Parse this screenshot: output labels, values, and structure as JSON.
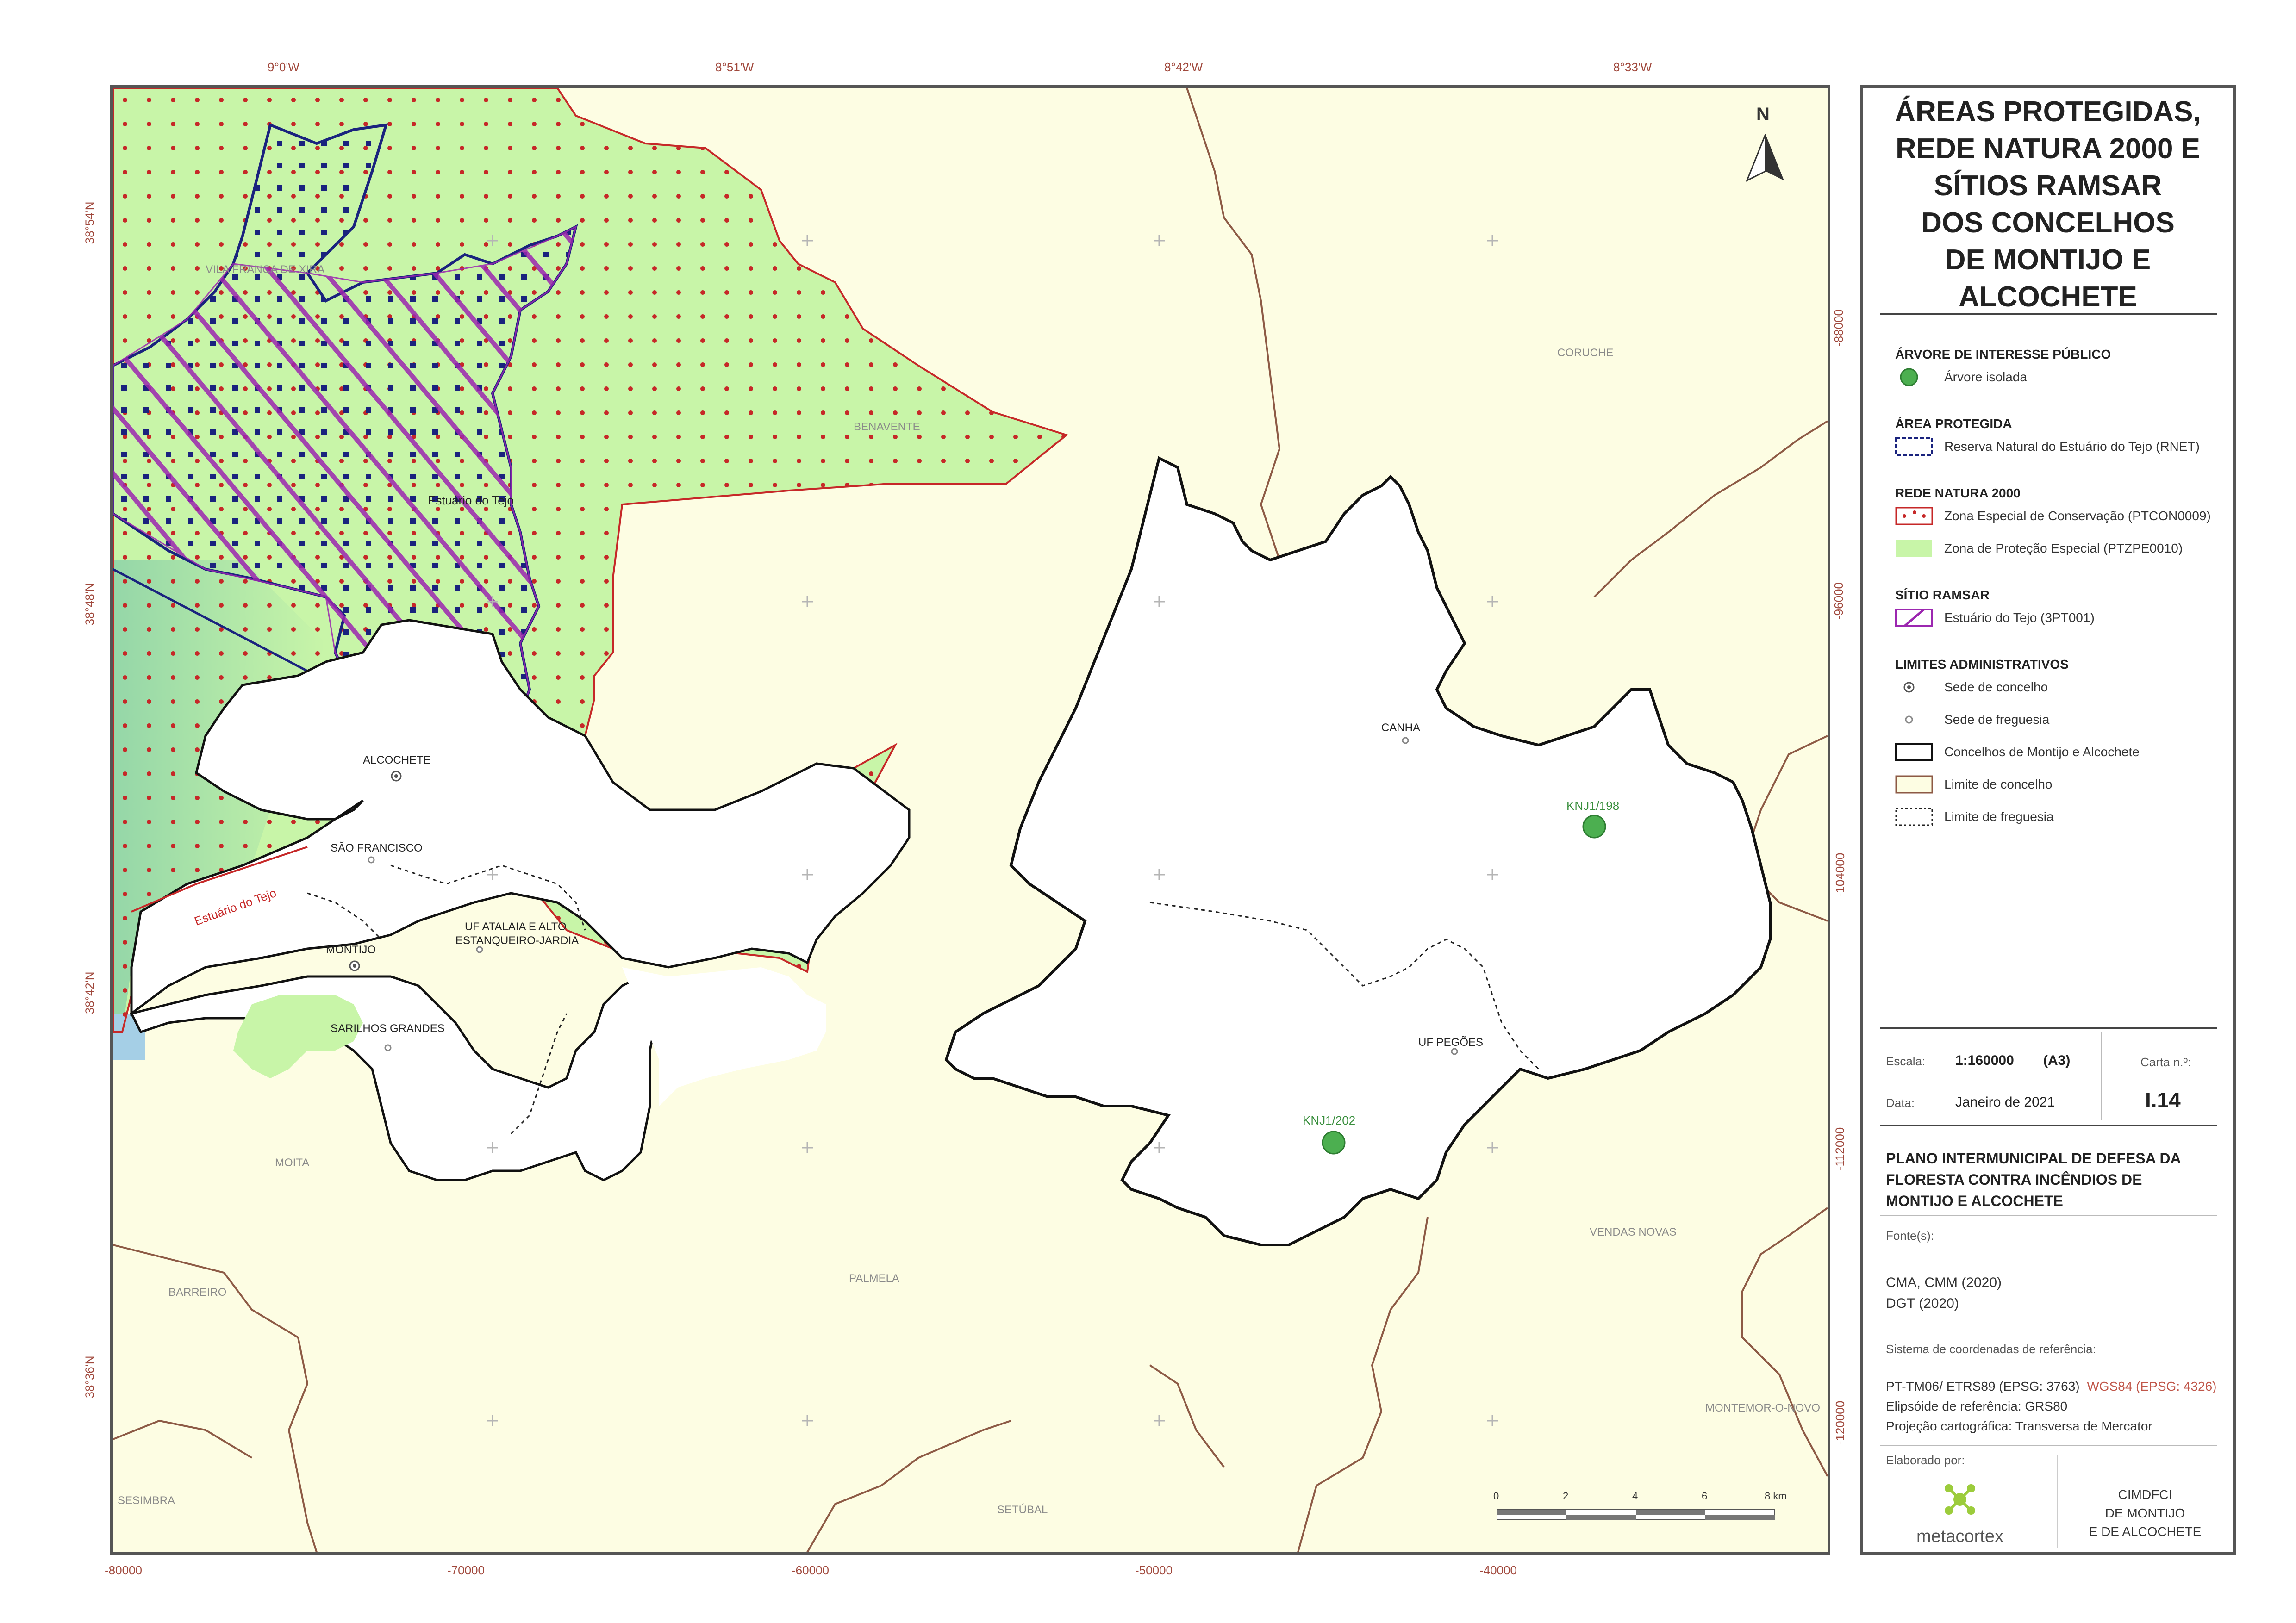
{
  "map": {
    "top_coords": [
      "9°0'W",
      "8°51'W",
      "8°42'W",
      "8°33'W"
    ],
    "left_coords": [
      "38°54'N",
      "38°48'N",
      "38°42'N",
      "38°36'N"
    ],
    "bottom_coords": [
      "-80000",
      "-70000",
      "-60000",
      "-50000",
      "-40000"
    ],
    "right_coords": [
      "-88000",
      "-96000",
      "-104000",
      "-112000",
      "-120000"
    ],
    "place_names": {
      "vila_franca": "VILA FRANCA DE XIRA",
      "benavente": "BENAVENTE",
      "coruche": "CORUCHE",
      "estuario": "Estuário do Tejo",
      "estuario_river": "Estuário do Tejo",
      "alcochete": "ALCOCHETE",
      "sao_francisco": "SÃO FRANCISCO",
      "uf_atalaia": "UF ATALAIA E ALTO",
      "uf_atalaia_2": "ESTANQUEIRO-JARDIA",
      "montijo": "MONTIJO",
      "sarilhos": "SARILHOS GRANDES",
      "moita": "MOITA",
      "barreiro": "BARREIRO",
      "palmela": "PALMELA",
      "sesimbra": "SESIMBRA",
      "setubal": "SETÚBAL",
      "canha": "CANHA",
      "uf_pegoes": "UF PEGÕES",
      "vendas_novas": "VENDAS NOVAS",
      "montemor": "MONTEMOR-O-NOVO"
    },
    "trees": [
      {
        "id": "KNJ1/198"
      },
      {
        "id": "KNJ1/202"
      }
    ],
    "north_label": "N",
    "scale_ticks": [
      "0",
      "2",
      "4",
      "6",
      "8 km"
    ]
  },
  "legend": {
    "title": [
      "ÁREAS PROTEGIDAS,",
      "REDE NATURA 2000 E",
      "SÍTIOS RAMSAR",
      "DOS CONCELHOS",
      "DE MONTIJO E",
      "ALCOCHETE"
    ],
    "sections": {
      "arvore_head": "ÁRVORE DE INTERESSE PÚBLICO",
      "arvore_item": "Árvore isolada",
      "area_head": "ÁREA PROTEGIDA",
      "area_item": "Reserva Natural do Estuário do Tejo (RNET)",
      "natura_head": "REDE NATURA 2000",
      "natura_item1": "Zona Especial de Conservação (PTCON0009)",
      "natura_item2": "Zona de Proteção Especial (PTZPE0010)",
      "ramsar_head": "SÍTIO RAMSAR",
      "ramsar_item": "Estuário do Tejo (3PT001)",
      "limites_head": "LIMITES ADMINISTRATIVOS",
      "lim1": "Sede de concelho",
      "lim2": "Sede de freguesia",
      "lim3": "Concelhos de Montijo e Alcochete",
      "lim4": "Limite de concelho",
      "lim5": "Limite de freguesia"
    },
    "colors": {
      "tree": "#4caf50",
      "rnet": "#1a237e",
      "zec_dots": "#c62828",
      "zpe": "#c8f5a8",
      "ramsar": "#9c27b0",
      "concelho_fill": "#fdfde3",
      "concelho_line": "#8d5a45"
    }
  },
  "info": {
    "escala_label": "Escala:",
    "escala_value": "1:160000",
    "paper": "(A3)",
    "data_label": "Data:",
    "data_value": "Janeiro de 2021",
    "carta_label": "Carta n.º:",
    "carta_value": "I.14",
    "plan_title": "PLANO INTERMUNICIPAL DE DEFESA DA FLORESTA CONTRA INCÊNDIOS DE MONTIJO E ALCOCHETE",
    "fontes_label": "Fonte(s):",
    "fonte1": "CMA, CMM (2020)",
    "fonte2": "DGT (2020)",
    "sistema_label": "Sistema de coordenadas de referência:",
    "sistema_1": "PT-TM06/ ETRS89 (EPSG: 3763)",
    "sistema_1b": "WGS84 (EPSG: 4326)",
    "sistema_2": "Elipsóide de referência: GRS80",
    "sistema_3": "Projeção cartográfica: Transversa de Mercator",
    "elaborado_label": "Elaborado por:",
    "logo_text": "metacortex",
    "org": [
      "CIMDFCI",
      "DE MONTIJO",
      "E DE ALCOCHETE"
    ]
  }
}
